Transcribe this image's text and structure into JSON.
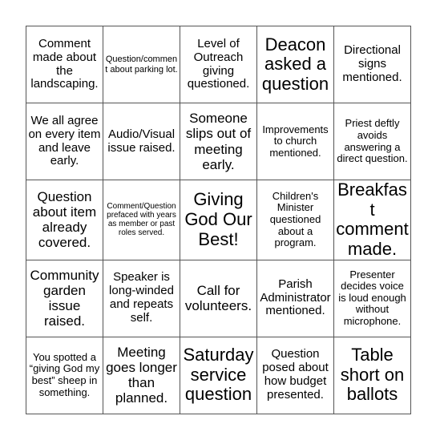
{
  "board": {
    "rows": [
      [
        {
          "text": "Comment made about the landscaping.",
          "size": "lg"
        },
        {
          "text": "Question/comment about parking lot.",
          "size": "sm"
        },
        {
          "text": "Level of Outreach giving questioned.",
          "size": "lg"
        },
        {
          "text": "Deacon asked a question",
          "size": "xxl"
        },
        {
          "text": "Directional signs mentioned.",
          "size": "lg"
        }
      ],
      [
        {
          "text": "We all agree on every item and leave early.",
          "size": "lg"
        },
        {
          "text": "Audio/Visual issue raised.",
          "size": "lg"
        },
        {
          "text": "Someone slips out of meeting early.",
          "size": "xl"
        },
        {
          "text": "Improvements to church mentioned.",
          "size": "md"
        },
        {
          "text": "Priest deftly avoids answering a direct question.",
          "size": "md"
        }
      ],
      [
        {
          "text": "Question about item already covered.",
          "size": "xl"
        },
        {
          "text": "Comment/Question prefaced with years as member or past roles served.",
          "size": "xs"
        },
        {
          "text": "Giving God Our Best!",
          "size": "xxl"
        },
        {
          "text": "Children's Minister questioned about a program.",
          "size": "md"
        },
        {
          "text": "Breakfast comment made.",
          "size": "xxl"
        }
      ],
      [
        {
          "text": "Community garden issue raised.",
          "size": "xl"
        },
        {
          "text": "Speaker is long-winded and repeats self.",
          "size": "lg"
        },
        {
          "text": "Call for volunteers.",
          "size": "xl"
        },
        {
          "text": "Parish Administrator mentioned.",
          "size": "lg"
        },
        {
          "text": "Presenter decides voice is loud enough without microphone.",
          "size": "md"
        }
      ],
      [
        {
          "text": "You spotted a “giving God my best” sheep in something.",
          "size": "md"
        },
        {
          "text": "Meeting goes longer than planned.",
          "size": "xl"
        },
        {
          "text": "Saturday service question",
          "size": "xxl"
        },
        {
          "text": "Question posed about how budget presented.",
          "size": "lg"
        },
        {
          "text": "Table short on ballots",
          "size": "xxl"
        }
      ]
    ]
  }
}
